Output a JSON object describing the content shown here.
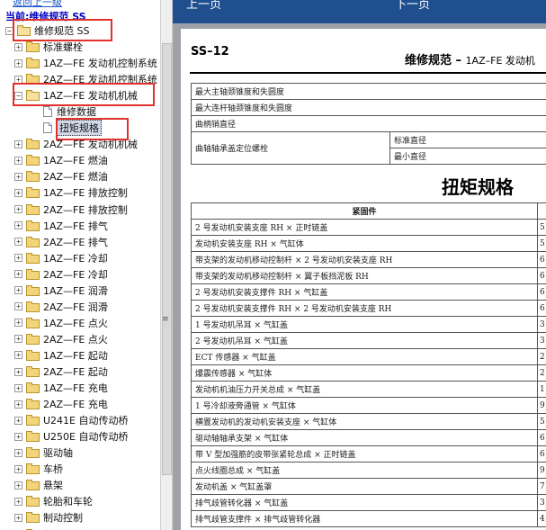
{
  "tree": {
    "top_link": "返回上一级",
    "current": "当前:维修规范 SS",
    "root": "维修规范 SS",
    "items": [
      "标准螺栓",
      "1AZ—FE 发动机控制系统",
      "2AZ—FE 发动机控制系统",
      "1AZ—FE 发动机机械",
      "维修数据",
      "扭矩规格",
      "2AZ—FE 发动机机械",
      "1AZ—FE 燃油",
      "2AZ—FE 燃油",
      "1AZ—FE 排放控制",
      "2AZ—FE 排放控制",
      "1AZ—FE 排气",
      "2AZ—FE 排气",
      "1AZ—FE 冷却",
      "2AZ—FE 冷却",
      "1AZ—FE 润滑",
      "2AZ—FE 润滑",
      "1AZ—FE 点火",
      "2AZ—FE 点火",
      "1AZ—FE 起动",
      "2AZ—FE 起动",
      "1AZ—FE 充电",
      "2AZ—FE 充电",
      "U241E 自动传动桥",
      "U250E 自动传动桥",
      "驱动轴",
      "车桥",
      "悬架",
      "轮胎和车轮",
      "制动控制",
      "制动器"
    ]
  },
  "nav": {
    "prev": "上一页",
    "next": "下一页"
  },
  "doc": {
    "page_code": "SS–12",
    "header_title": "维修规范 –",
    "header_sub": "1AZ–FE 发动机",
    "spec_rows": [
      "最大主轴颈锥度和失圆度",
      "最大连杆轴颈锥度和失圆度",
      "曲柄销直径",
      "曲轴轴承盖定位螺栓"
    ],
    "spec_sub": [
      "标准直径",
      "最小直径"
    ],
    "torque_title": "扭矩规格",
    "torque_header": "紧固件",
    "torque_rows": [
      "2 号发动机安装支座 RH × 正时链盖",
      "发动机安装支座 RH × 气缸体",
      "带支架的发动机移动控制杆 × 2 号发动机安装支座 RH",
      "带支架的发动机移动控制杆 × 翼子板挡泥板 RH",
      "2 号发动机安装支撑件 RH × 气缸盖",
      "2 号发动机安装支撑件 RH × 2 号发动机安装支座 RH",
      "1 号发动机吊耳 × 气缸盖",
      "2 号发动机吊耳 × 气缸盖",
      "ECT 传感器 × 气缸盖",
      "爆震传感器 × 气缸体",
      "发动机机油压力开关总成 × 气缸盖",
      "1 号冷却液旁通管 × 气缸体",
      "横置发动机的发动机安装支座 × 气缸体",
      "驱动轴轴承支架 × 气缸体",
      "带 V 型加强筋的皮带张紧轮总成 × 正时链盖",
      "点火线圈总成 × 气缸盖",
      "发动机盖 × 气缸盖罩",
      "排气歧管转化器 × 气缸盖",
      "排气歧管支撑件 × 排气歧管转化器"
    ],
    "torque_values": [
      "5",
      "5",
      "6",
      "6",
      "6",
      "6",
      "3",
      "3",
      "2",
      "2",
      "1",
      "9",
      "5",
      "6",
      "6",
      "9",
      "7",
      "3",
      "4"
    ]
  }
}
